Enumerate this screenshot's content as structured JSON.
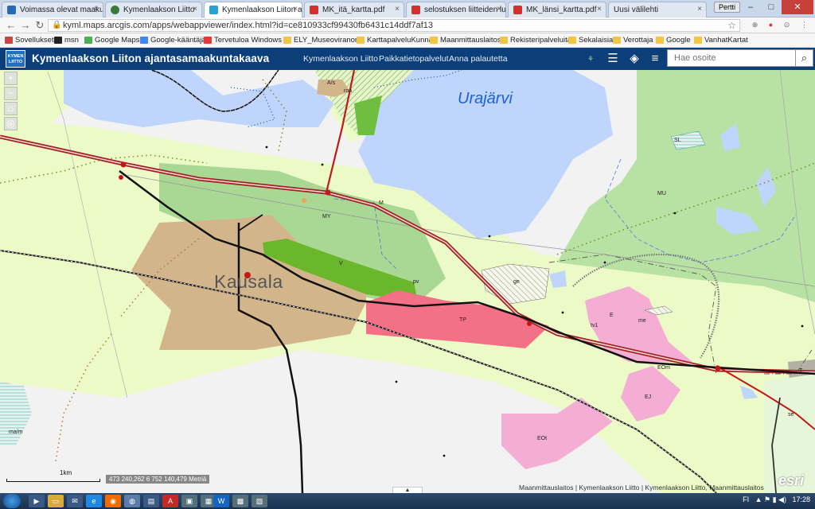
{
  "browser": {
    "tabs": [
      {
        "label": "Voimassa olevat maaku",
        "color": "#2a6ab5"
      },
      {
        "label": "Kymenlaakson Liitto",
        "color": "#3a7a3a"
      },
      {
        "label": "Kymenlaakson Liiton aja",
        "color": "#2aa1d6"
      },
      {
        "label": "MK_itä_kartta.pdf",
        "color": "#d32f2f"
      },
      {
        "label": "selostuksen liitteiden lu",
        "color": "#d32f2f"
      },
      {
        "label": "MK_länsi_kartta.pdf",
        "color": "#d32f2f"
      },
      {
        "label": "Uusi välilehti",
        "color": "#dfe7f2"
      }
    ],
    "profile_label": "Pertti",
    "url": "kyml.maps.arcgis.com/apps/webappviewer/index.html?id=ce810933cf99430fb6431c14ddf7af13",
    "bookmarks": [
      {
        "label": "Sovellukset",
        "color": "#c44"
      },
      {
        "label": "msn",
        "color": "#222"
      },
      {
        "label": "Google Maps",
        "color": "#4caf50"
      },
      {
        "label": "Google-kääntäjä",
        "color": "#4285f4"
      },
      {
        "label": "Tervetuloa Windows L",
        "color": "#e53935"
      },
      {
        "label": "ELY_Museoviranom",
        "color": "#f4c542"
      },
      {
        "label": "KarttapalveluKunnat",
        "color": "#f4c542"
      },
      {
        "label": "Maanmittauslaitos",
        "color": "#f4c542"
      },
      {
        "label": "Rekisteripalveluita",
        "color": "#f4c542"
      },
      {
        "label": "Sekalaisia",
        "color": "#f4c542"
      },
      {
        "label": "Verottaja",
        "color": "#f4c542"
      },
      {
        "label": "Google",
        "color": "#f4c542"
      },
      {
        "label": "VanhatKartat",
        "color": "#f4c542"
      }
    ]
  },
  "app": {
    "logo_text": "KYMEN LIITTO",
    "title": "Kymenlaakson Liiton ajantasamaakuntakaava",
    "links": [
      "Kymenlaakson Liitto",
      "Paikkatietopalvelut",
      "Anna palautetta"
    ],
    "search_placeholder": "Hae osoite",
    "search_icon": "search-icon"
  },
  "map": {
    "place_labels": {
      "town": "Kausala",
      "lake": "Urajärvi"
    },
    "zone_labels": [
      "A/s",
      "roa",
      "SL",
      "MU",
      "M",
      "MY",
      "V",
      "pv",
      "ge",
      "TP",
      "E",
      "me",
      "tv1",
      "EOm",
      "EJ",
      "EOt",
      "T",
      "se",
      "ma/m"
    ],
    "scale_label": "1km",
    "coordinates": "473 240,262 6 752 140,479 Metriä",
    "attribution": "Maanmittauslaitos | Kymenlaakson Liitto | Kymenlaakson Liitto, Maanmittauslaitos",
    "brand": "esri"
  },
  "taskbar": {
    "language": "FI",
    "time": "17:28"
  }
}
